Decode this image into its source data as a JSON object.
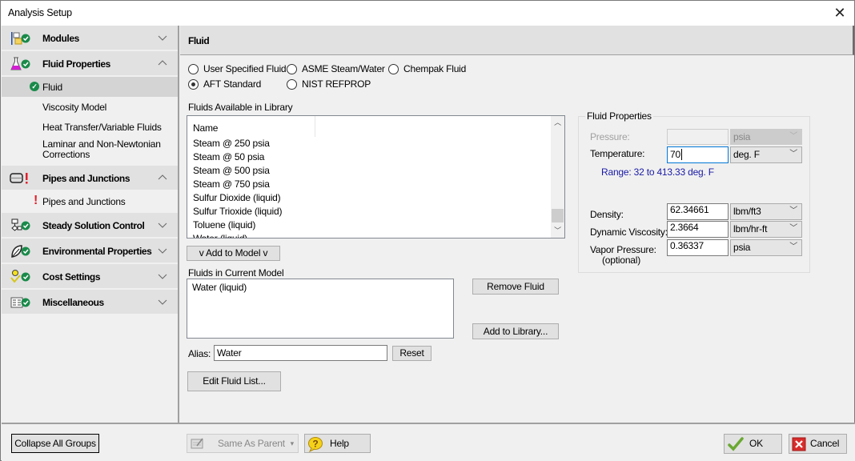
{
  "window": {
    "title": "Analysis Setup",
    "close_icon": "close-icon"
  },
  "sidebar": {
    "groups": [
      {
        "label": "Modules",
        "icon": "modules-icon",
        "status": "ok",
        "expanded": false,
        "items": []
      },
      {
        "label": "Fluid Properties",
        "icon": "flask-icon",
        "status": "ok",
        "expanded": true,
        "items": [
          {
            "label": "Fluid",
            "status": "ok",
            "selected": true
          },
          {
            "label": "Viscosity Model"
          },
          {
            "label": "Heat Transfer/Variable Fluids"
          },
          {
            "label": "Laminar and Non-Newtonian Corrections"
          }
        ]
      },
      {
        "label": "Pipes and Junctions",
        "icon": "pipe-icon",
        "status": "error",
        "expanded": true,
        "items": [
          {
            "label": "Pipes and Junctions",
            "status": "error"
          }
        ]
      },
      {
        "label": "Steady Solution Control",
        "icon": "flowchart-icon",
        "status": "ok",
        "expanded": false
      },
      {
        "label": "Environmental Properties",
        "icon": "leaf-icon",
        "status": "ok",
        "expanded": false
      },
      {
        "label": "Cost Settings",
        "icon": "cost-icon",
        "status": "ok",
        "expanded": false
      },
      {
        "label": "Miscellaneous",
        "icon": "misc-icon",
        "status": "ok",
        "expanded": false
      }
    ]
  },
  "panel": {
    "title": "Fluid",
    "fluid_source": {
      "options": [
        "User Specified Fluid",
        "ASME Steam/Water",
        "Chempak Fluid",
        "AFT Standard",
        "NIST REFPROP"
      ],
      "selected": "AFT Standard"
    },
    "library": {
      "label": "Fluids Available in Library",
      "column_header": "Name",
      "rows": [
        "Steam @ 250 psia",
        "Steam @ 50 psia",
        "Steam @ 500 psia",
        "Steam @ 750 psia",
        "Sulfur Dioxide (liquid)",
        "Sulfur Trioxide (liquid)",
        "Toluene (liquid)",
        "Water (liquid)"
      ],
      "add_button": "v  Add to Model  v"
    },
    "model": {
      "label": "Fluids in Current Model",
      "rows": [
        "Water (liquid)"
      ],
      "remove_button": "Remove Fluid",
      "add_library_button": "Add to Library...",
      "alias_label": "Alias:",
      "alias_value": "Water",
      "reset_button": "Reset",
      "edit_list_button": "Edit Fluid List..."
    },
    "properties": {
      "title": "Fluid Properties",
      "pressure": {
        "label": "Pressure:",
        "value": "",
        "unit": "psia",
        "disabled": true
      },
      "temperature": {
        "label": "Temperature:",
        "value": "70",
        "unit": "deg. F"
      },
      "range_text": "Range: 32 to 413.33 deg. F",
      "density": {
        "label": "Density:",
        "value": "62.34661",
        "unit": "lbm/ft3"
      },
      "viscosity": {
        "label": "Dynamic Viscosity:",
        "value": "2.3664",
        "unit": "lbm/hr-ft"
      },
      "vapor": {
        "label": "Vapor Pressure:",
        "sublabel": "(optional)",
        "value": "0.36337",
        "unit": "psia"
      }
    },
    "colors": {
      "range_text": "#1a1aa6",
      "ok_badge": "#1a8a4a",
      "error": "#e0202a"
    }
  },
  "footer": {
    "collapse_button": "Collapse All Groups",
    "same_as_parent": "Same As Parent",
    "help_button": "Help",
    "ok_button": "OK",
    "cancel_button": "Cancel"
  }
}
